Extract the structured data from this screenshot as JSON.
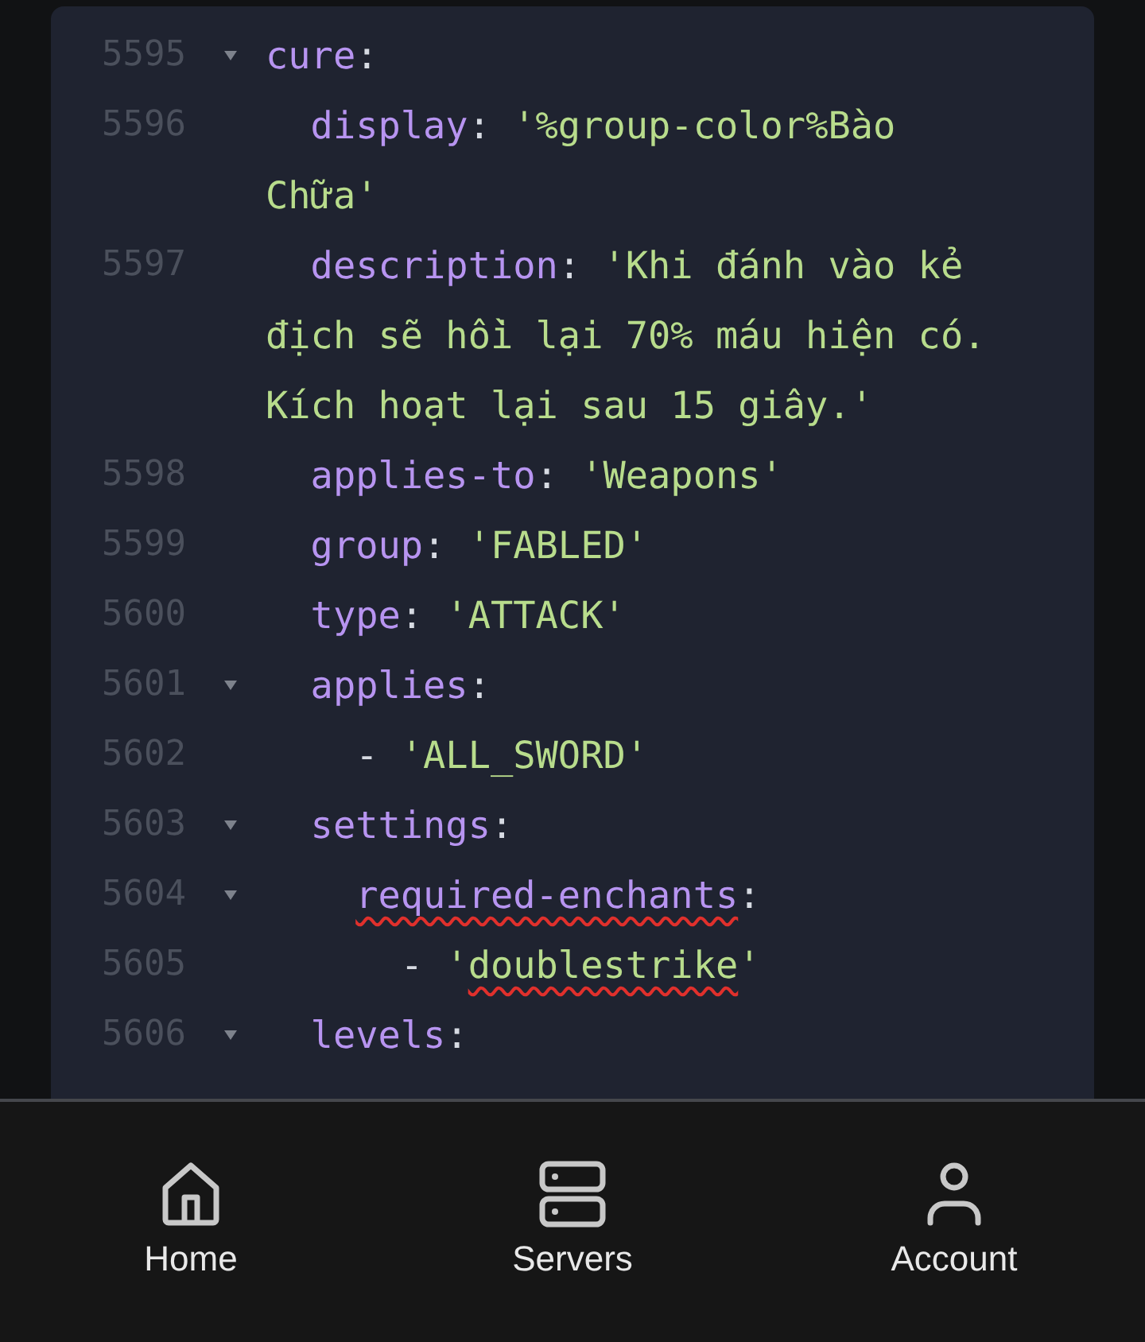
{
  "editor": {
    "lines": [
      {
        "number": "5595",
        "foldable": true,
        "tokens": [
          {
            "kind": "key",
            "text": "cure"
          },
          {
            "kind": "punct",
            "text": ":"
          }
        ],
        "children": [
          {
            "number": "5596",
            "foldable": false,
            "tokens": [
              {
                "kind": "key",
                "text": "display"
              },
              {
                "kind": "punct",
                "text": ": "
              },
              {
                "kind": "string",
                "text": "'%group-color%Bào Chữa'"
              }
            ]
          },
          {
            "number": "5597",
            "foldable": false,
            "tokens": [
              {
                "kind": "key",
                "text": "description"
              },
              {
                "kind": "punct",
                "text": ": "
              },
              {
                "kind": "string",
                "text": "'Khi đánh vào kẻ địch sẽ hồi lại 70% máu hiện có. Kích hoạt lại sau 15 giây.'"
              }
            ]
          },
          {
            "number": "5598",
            "foldable": false,
            "tokens": [
              {
                "kind": "key",
                "text": "applies-to"
              },
              {
                "kind": "punct",
                "text": ": "
              },
              {
                "kind": "string",
                "text": "'Weapons'"
              }
            ]
          },
          {
            "number": "5599",
            "foldable": false,
            "tokens": [
              {
                "kind": "key",
                "text": "group"
              },
              {
                "kind": "punct",
                "text": ": "
              },
              {
                "kind": "string",
                "text": "'FABLED'"
              }
            ]
          },
          {
            "number": "5600",
            "foldable": false,
            "tokens": [
              {
                "kind": "key",
                "text": "type"
              },
              {
                "kind": "punct",
                "text": ": "
              },
              {
                "kind": "string",
                "text": "'ATTACK'"
              }
            ]
          },
          {
            "number": "5601",
            "foldable": true,
            "tokens": [
              {
                "kind": "key",
                "text": "applies"
              },
              {
                "kind": "punct",
                "text": ":"
              }
            ],
            "children": [
              {
                "number": "5602",
                "foldable": false,
                "tokens": [
                  {
                    "kind": "punct",
                    "text": "- "
                  },
                  {
                    "kind": "string",
                    "text": "'ALL_SWORD'"
                  }
                ]
              }
            ]
          },
          {
            "number": "5603",
            "foldable": true,
            "tokens": [
              {
                "kind": "key",
                "text": "settings"
              },
              {
                "kind": "punct",
                "text": ":"
              }
            ],
            "children": [
              {
                "number": "5604",
                "foldable": true,
                "tokens": [
                  {
                    "kind": "key",
                    "text": "required-enchants",
                    "misspelled": true
                  },
                  {
                    "kind": "punct",
                    "text": ":"
                  }
                ],
                "children": [
                  {
                    "number": "5605",
                    "foldable": false,
                    "tokens": [
                      {
                        "kind": "punct",
                        "text": "- "
                      },
                      {
                        "kind": "string",
                        "text": "'"
                      },
                      {
                        "kind": "string",
                        "text": "doublestrike",
                        "misspelled": true
                      },
                      {
                        "kind": "string",
                        "text": "'"
                      }
                    ]
                  }
                ]
              }
            ]
          },
          {
            "number": "5606",
            "foldable": true,
            "tokens": [
              {
                "kind": "key",
                "text": "levels"
              },
              {
                "kind": "punct",
                "text": ":"
              }
            ]
          }
        ]
      }
    ]
  },
  "nav": [
    {
      "label": "Home"
    },
    {
      "label": "Servers"
    },
    {
      "label": "Account"
    }
  ]
}
